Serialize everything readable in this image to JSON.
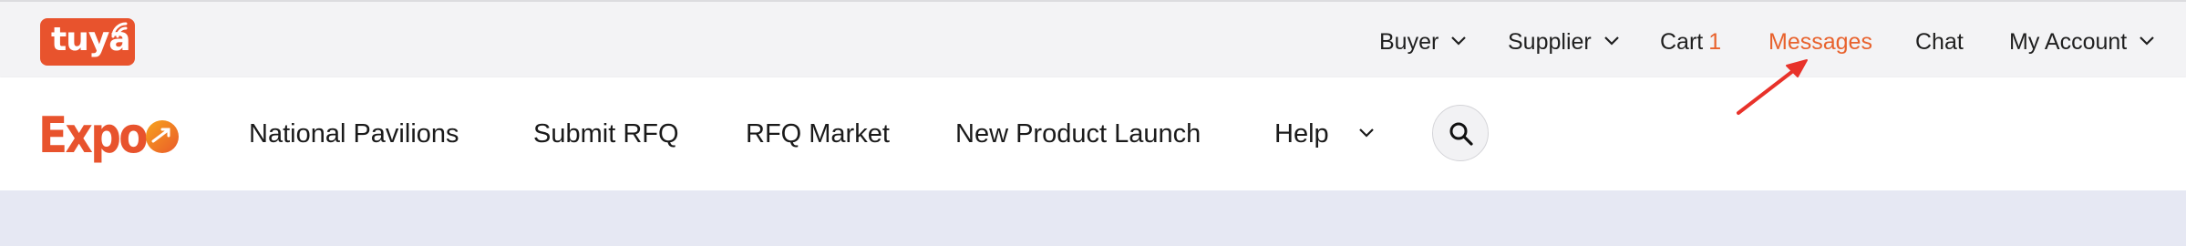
{
  "brand": {
    "tuya_logo_text": "tuya",
    "expo_logo_text": "Expo"
  },
  "top_nav": {
    "buyer": "Buyer",
    "supplier": "Supplier",
    "cart": "Cart",
    "cart_count": "1",
    "messages": "Messages",
    "chat": "Chat",
    "my_account": "My Account"
  },
  "main_nav": {
    "national_pavilions": "National Pavilions",
    "submit_rfq": "Submit RFQ",
    "rfq_market": "RFQ Market",
    "new_product_launch": "New Product Launch",
    "help": "Help"
  },
  "colors": {
    "accent": "#e8622d",
    "logo_bg": "#e8532d",
    "top_bar_bg": "#f3f3f5",
    "page_bg": "#e6e8f3",
    "annotation_arrow": "#e8322a"
  },
  "icons": [
    "chevron-down-icon",
    "search-icon",
    "wifi-signal-icon",
    "arrow-annotation"
  ]
}
